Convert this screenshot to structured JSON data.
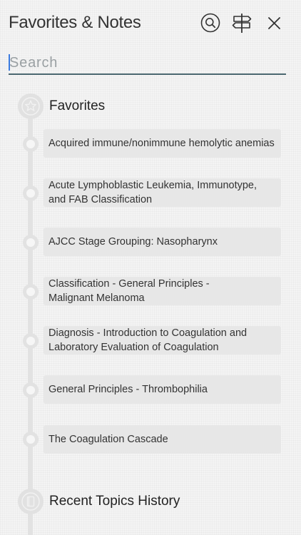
{
  "header": {
    "title": "Favorites & Notes",
    "icons": [
      "search-icon",
      "signpost-icon",
      "close-icon"
    ]
  },
  "search": {
    "placeholder": "Search",
    "value": ""
  },
  "favorites": {
    "title": "Favorites",
    "icon": "star-icon",
    "items": [
      {
        "label": "Acquired immune/nonimmune hemolytic anemias"
      },
      {
        "label": "Acute Lymphoblastic Leukemia, Immunotype, and FAB Classification"
      },
      {
        "label": "AJCC Stage Grouping: Nasopharynx"
      },
      {
        "label": "Classification - General Principles - Malignant Melanoma"
      },
      {
        "label": "Diagnosis - Introduction to Coagulation and Laboratory Evaluation of Coagulation"
      },
      {
        "label": "General Principles - Thrombophilia"
      },
      {
        "label": "The Coagulation Cascade"
      }
    ]
  },
  "history": {
    "title": "Recent Topics History",
    "icon": "book-icon"
  },
  "colors": {
    "search_underline": "#4a6770",
    "caret": "#3b7be0",
    "card_background": "#e7e7e7",
    "timeline": "#e2e2e2"
  }
}
